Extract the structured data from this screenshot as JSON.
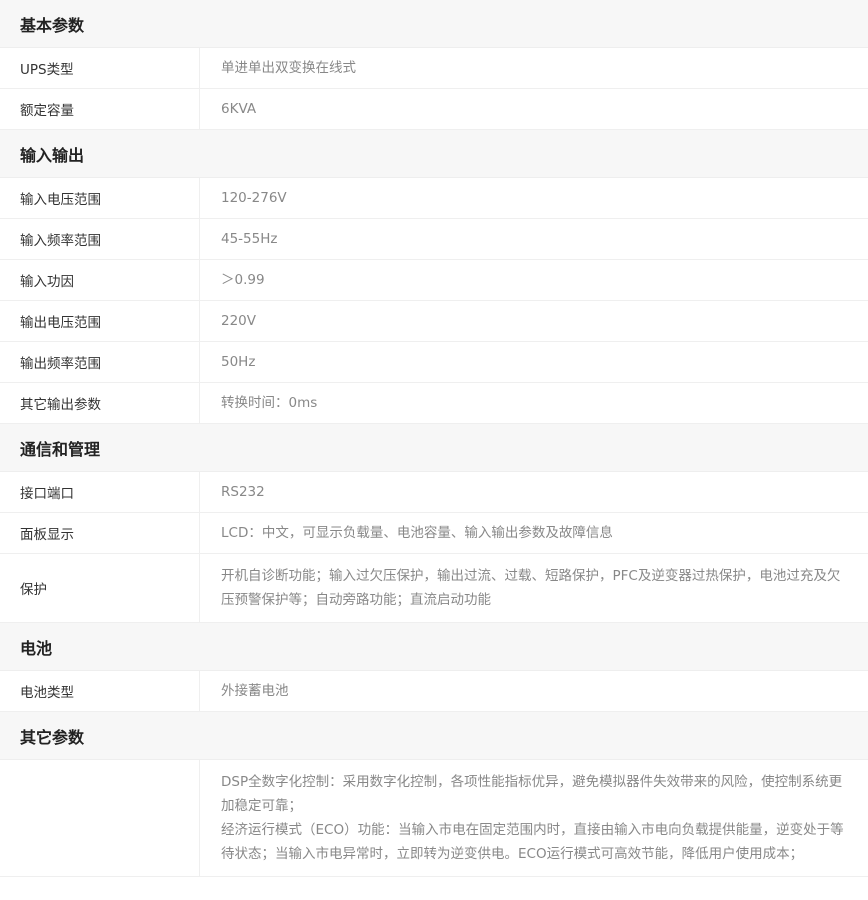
{
  "sections": [
    {
      "title": "基本参数",
      "rows": [
        {
          "label": "UPS类型",
          "value": "单进单出双变换在线式"
        },
        {
          "label": "额定容量",
          "value": "6KVA"
        }
      ]
    },
    {
      "title": "输入输出",
      "rows": [
        {
          "label": "输入电压范围",
          "value": "120-276V"
        },
        {
          "label": "输入频率范围",
          "value": "45-55Hz"
        },
        {
          "label": "输入功因",
          "value": "＞0.99"
        },
        {
          "label": "输出电压范围",
          "value": "220V"
        },
        {
          "label": "输出频率范围",
          "value": "50Hz"
        },
        {
          "label": "其它输出参数",
          "value": "转换时间：0ms"
        }
      ]
    },
    {
      "title": "通信和管理",
      "rows": [
        {
          "label": "接口端口",
          "value": "RS232"
        },
        {
          "label": "面板显示",
          "value": "LCD：中文，可显示负载量、电池容量、输入输出参数及故障信息"
        },
        {
          "label": "保护",
          "value": "开机自诊断功能；输入过欠压保护，输出过流、过载、短路保护，PFC及逆变器过热保护，电池过充及欠压预警保护等；自动旁路功能；直流启动功能"
        }
      ]
    },
    {
      "title": "电池",
      "rows": [
        {
          "label": "电池类型",
          "value": "外接蓄电池"
        }
      ]
    },
    {
      "title": "其它参数",
      "rows": [
        {
          "label": "",
          "value_lines": [
            "DSP全数字化控制：采用数字化控制，各项性能指标优异，避免模拟器件失效带来的风险，使控制系统更加稳定可靠；",
            "经济运行模式（ECO）功能：当输入市电在固定范围内时，直接由输入市电向负载提供能量，逆变处于等待状态；当输入市电异常时，立即转为逆变供电。ECO运行模式可高效节能，降低用户使用成本；"
          ]
        }
      ]
    }
  ]
}
